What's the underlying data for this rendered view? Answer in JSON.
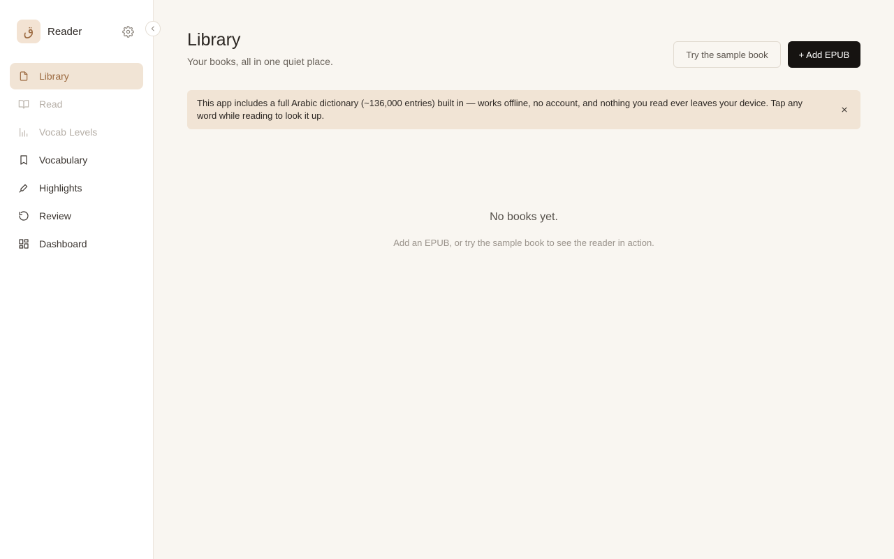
{
  "sidebar": {
    "brand": {
      "logo_glyph": "ق",
      "name": "Reader"
    },
    "items": [
      {
        "label": "Library",
        "icon": "file-icon",
        "state": "active"
      },
      {
        "label": "Read",
        "icon": "book-open-icon",
        "state": "disabled"
      },
      {
        "label": "Vocab Levels",
        "icon": "bar-chart-icon",
        "state": "disabled"
      },
      {
        "label": "Vocabulary",
        "icon": "bookmark-icon",
        "state": "normal"
      },
      {
        "label": "Highlights",
        "icon": "highlighter-icon",
        "state": "normal"
      },
      {
        "label": "Review",
        "icon": "history-icon",
        "state": "normal"
      },
      {
        "label": "Dashboard",
        "icon": "dashboard-icon",
        "state": "normal"
      }
    ]
  },
  "header": {
    "title": "Library",
    "subtitle": "Your books, all in one quiet place.",
    "sample_label": "Try the sample book",
    "add_label": "+ Add EPUB"
  },
  "banner": {
    "text": "This app includes a full Arabic dictionary (~136,000 entries) built in — works offline, no account, and nothing you read ever leaves your device. Tap any word while reading to look it up."
  },
  "empty_state": {
    "title": "No books yet.",
    "subtitle": "Add an EPUB, or try the sample book to see the reader in action."
  },
  "colors": {
    "accent": "#9c6a40",
    "active_bg": "#f1e4d5",
    "page_bg": "#f9f6f1",
    "primary_button": "#161311"
  }
}
